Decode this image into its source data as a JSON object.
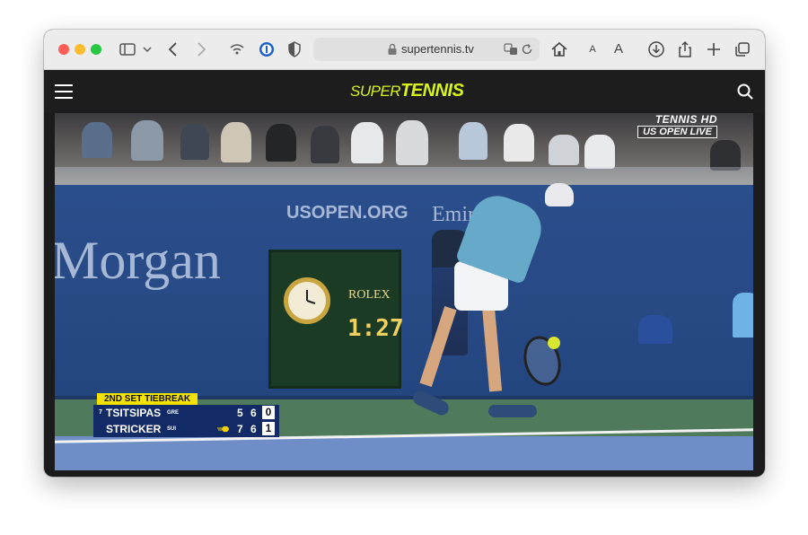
{
  "browser": {
    "url": "supertennis.tv",
    "colors": {
      "close": "#ff5f57",
      "minimize": "#febc2e",
      "zoom": "#28c840"
    },
    "icons": [
      "sidebar-icon",
      "chevron-down-icon",
      "back-icon",
      "forward-icon",
      "shield-wifi-icon",
      "password-icon",
      "privacy-shield-icon",
      "lock-icon",
      "translate-icon",
      "reload-icon",
      "home-icon",
      "text-smaller-icon",
      "text-larger-icon",
      "download-icon",
      "share-icon",
      "new-tab-icon",
      "tabs-overview-icon"
    ],
    "text_small": "A",
    "text_large": "A"
  },
  "site": {
    "logo_super": "SUPER",
    "logo_tennis": "TENNIS",
    "accent_color": "#d8f21a",
    "icons": [
      "menu-icon",
      "search-icon"
    ]
  },
  "video": {
    "broadcast_channel": "TENNIS HD",
    "broadcast_label": "US OPEN LIVE",
    "wall_text_url": "USOPEN.ORG",
    "wall_text_sponsor": "Morgan",
    "wall_text_sponsor2": "Emirates",
    "clock_brand": "ROLEX",
    "clock_time": "1:27"
  },
  "scoreboard": {
    "tag": "2ND SET TIEBREAK",
    "players": [
      {
        "seed": "7",
        "name": "TSITSIPAS",
        "country": "GRE",
        "set1": "5",
        "set2": "6",
        "points": "0",
        "serving": false
      },
      {
        "seed": "",
        "name": "STRICKER",
        "country": "SUI",
        "set1": "7",
        "set2": "6",
        "points": "1",
        "serving": true
      }
    ]
  }
}
